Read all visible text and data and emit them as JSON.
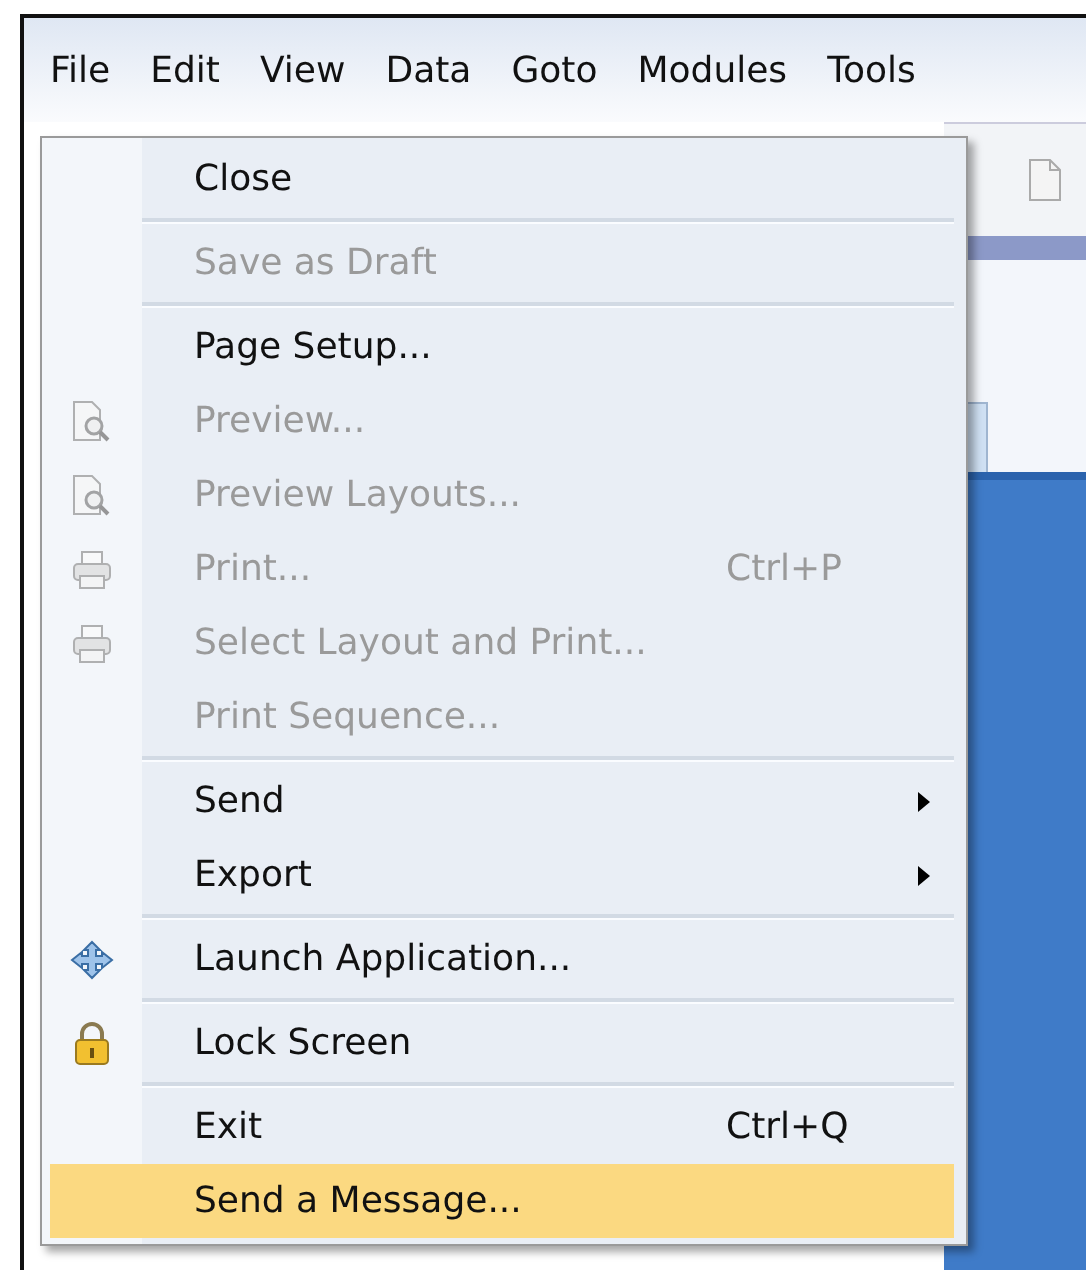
{
  "menubar": [
    {
      "label": "File"
    },
    {
      "label": "Edit"
    },
    {
      "label": "View"
    },
    {
      "label": "Data"
    },
    {
      "label": "Goto"
    },
    {
      "label": "Modules"
    },
    {
      "label": "Tools"
    }
  ],
  "file_menu": [
    {
      "kind": "plain",
      "label": "Close",
      "disabled": false,
      "selected": false
    },
    {
      "kind": "separator"
    },
    {
      "kind": "plain",
      "label": "Save as Draft",
      "disabled": true,
      "selected": false
    },
    {
      "kind": "separator"
    },
    {
      "kind": "plain",
      "label": "Page Setup...",
      "disabled": false,
      "selected": false
    },
    {
      "kind": "preview",
      "label": "Preview...",
      "disabled": true,
      "selected": false
    },
    {
      "kind": "preview",
      "label": "Preview Layouts...",
      "disabled": true,
      "selected": false
    },
    {
      "kind": "print",
      "label": "Print...",
      "shortcut": "Ctrl+P",
      "disabled": true,
      "selected": false
    },
    {
      "kind": "print",
      "label": "Select Layout and Print...",
      "disabled": true,
      "selected": false
    },
    {
      "kind": "plain",
      "label": "Print Sequence...",
      "disabled": true,
      "selected": false
    },
    {
      "kind": "separator"
    },
    {
      "kind": "plain",
      "label": "Send",
      "submenu": true,
      "disabled": false,
      "selected": false
    },
    {
      "kind": "plain",
      "label": "Export",
      "submenu": true,
      "disabled": false,
      "selected": false
    },
    {
      "kind": "separator"
    },
    {
      "kind": "launch",
      "label": "Launch Application...",
      "disabled": false,
      "selected": false
    },
    {
      "kind": "separator"
    },
    {
      "kind": "lock",
      "label": "Lock Screen",
      "disabled": false,
      "selected": false
    },
    {
      "kind": "separator"
    },
    {
      "kind": "plain",
      "label": "Exit",
      "shortcut": "Ctrl+Q",
      "disabled": false,
      "selected": false
    },
    {
      "kind": "plain",
      "label": "Send a Message...",
      "disabled": false,
      "selected": true
    }
  ]
}
